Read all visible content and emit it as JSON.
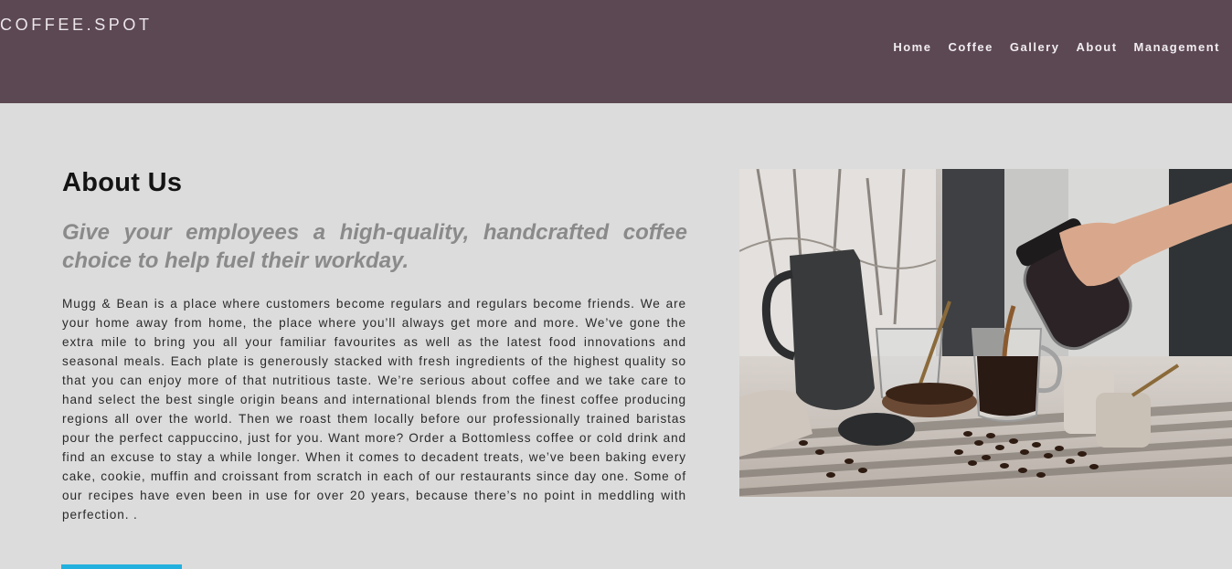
{
  "header": {
    "logo": "COFFEE.SPOT",
    "nav": [
      {
        "label": "Home"
      },
      {
        "label": "Coffee"
      },
      {
        "label": "Gallery"
      },
      {
        "label": "About"
      },
      {
        "label": "Management"
      }
    ],
    "bg_color": "#5c4853"
  },
  "about": {
    "title": "About Us",
    "tagline": "Give your employees a high-quality, handcrafted coffee choice to help fuel their workday.",
    "body": "Mugg & Bean is a place where customers become regulars and regulars become friends. We are your home away from home, the place where you’ll always get more and more. We’ve gone the extra mile to bring you all your familiar favourites as well as the latest food innovations and seasonal meals. Each plate is generously stacked with fresh ingredients of the highest quality so that you can enjoy more of that nutritious taste. We’re serious about coffee and we take care to hand select the best single origin beans and international blends from the finest coffee producing regions all over the world. Then we roast them locally before our professionally trained baristas pour the perfect cappuccino, just for you. Want more? Order a Bottomless coffee or cold drink and find an excuse to stay a while longer. When it comes to decadent treats, we’ve been baking every cake, cookie, muffin and croissant from scratch in each of our restaurants since day one. Some of our recipes have even been in use for over 20 years, because there’s no point in meddling with perfection. .",
    "accent_color": "#22b0de"
  },
  "photo": {
    "subject": "coffee-pouring-photo"
  }
}
